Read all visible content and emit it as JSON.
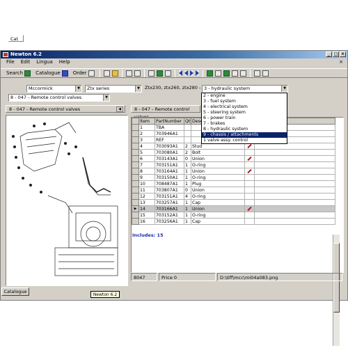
{
  "window": {
    "title": "Newton 6.2",
    "controls": [
      "_",
      "□",
      "×"
    ]
  },
  "menu": [
    "File",
    "Edit",
    "Lingua",
    "Help"
  ],
  "mdi_close": "×",
  "toolbar": {
    "search_label": "Search",
    "catalogue_label": "Catalogue",
    "order_label": "Order"
  },
  "filters": {
    "cat_label": "Cat",
    "brand": "Mccormick",
    "series": "Ztx series",
    "models": "Ztx230, ztx260, ztx280 -",
    "group": "3 - hydraulic system",
    "section": "8 - 047  - Remote control valves"
  },
  "group_options": [
    "2 - engine",
    "3 - fuel system",
    "4 - electrical system",
    "5 - steering system",
    "6 - power train",
    "7 - brakes",
    "8 - hydraulic system",
    "9 - chassis / attachments",
    "1 valve assy. control"
  ],
  "group_selected_index": 7,
  "left_panel": {
    "title": "8 - 047  - Remote control valves"
  },
  "right_panel": {
    "title": "8 - 047  - Remote control valves"
  },
  "table": {
    "columns": [
      "Item",
      "PartNumber",
      "Qty",
      "Description"
    ],
    "rows": [
      {
        "item": "1",
        "part": "TBA",
        "qty": "",
        "desc": ""
      },
      {
        "item": "2",
        "part": "703946A1",
        "qty": "",
        "desc": ""
      },
      {
        "item": "3",
        "part": "REF",
        "qty": "",
        "desc": ""
      },
      {
        "item": "4",
        "part": "703093A1",
        "qty": "2",
        "desc": "Stud"
      },
      {
        "item": "5",
        "part": "703080A1",
        "qty": "2",
        "desc": "Bolt"
      },
      {
        "item": "6",
        "part": "703143A1",
        "qty": "0",
        "desc": "Union"
      },
      {
        "item": "7",
        "part": "703151A1",
        "qty": "1",
        "desc": "O-ring"
      },
      {
        "item": "8",
        "part": "703164A1",
        "qty": "1",
        "desc": "Union"
      },
      {
        "item": "9",
        "part": "703150A1",
        "qty": "1",
        "desc": "O-ring"
      },
      {
        "item": "10",
        "part": "708487A1",
        "qty": "1",
        "desc": "Plug"
      },
      {
        "item": "11",
        "part": "703807A1",
        "qty": "0",
        "desc": "Union"
      },
      {
        "item": "12",
        "part": "703151A1",
        "qty": "4",
        "desc": "O-ring"
      },
      {
        "item": "13",
        "part": "703257A1",
        "qty": "1",
        "desc": "Cap"
      },
      {
        "item": "14",
        "part": "703166A1",
        "qty": "1",
        "desc": "Union"
      },
      {
        "item": "15",
        "part": "703152A1",
        "qty": "1",
        "desc": "O-ring"
      },
      {
        "item": "16",
        "part": "703256A1",
        "qty": "1",
        "desc": "Cap"
      }
    ],
    "selected_row_index": 13
  },
  "includes": "Includes: 15",
  "status": {
    "code": "8047",
    "price": "Price 0",
    "path": "D:\\tiff\\mcc\\mi04a083.png"
  },
  "bottom_tab": "Catalogue",
  "taskbar_tooltip": "Newton 6.2"
}
